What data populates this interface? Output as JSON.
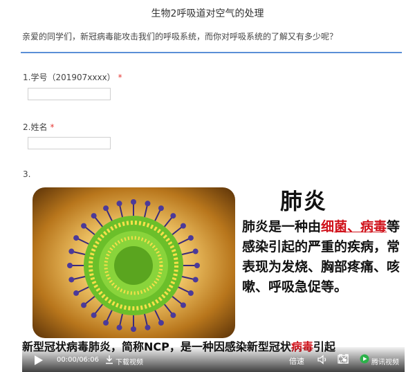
{
  "page": {
    "title": "生物2呼吸道对空气的处理",
    "intro": "亲爱的同学们，新冠病毒能攻击我们的呼吸系统，而你对呼吸系统的了解又有多少呢？"
  },
  "questions": [
    {
      "label": "1.学号（201907xxxx）",
      "required_mark": "*",
      "value": ""
    },
    {
      "label": "2.姓名",
      "required_mark": "*",
      "value": ""
    },
    {
      "label": "3."
    }
  ],
  "video": {
    "slide_title": "肺炎",
    "slide_text_1": "肺炎是一种由",
    "slide_text_red_1": "细",
    "slide_text_red_2": "菌、病毒",
    "slide_text_2": "等感染引起的严重的疾病，常表现为发烧、胸部疼痛、咳嗽、呼吸急促等。",
    "bottom_text_1": "新型冠状病毒肺炎，简称NCP，是一种因感染新型冠状",
    "bottom_text_red": "病毒",
    "bottom_text_2": "引起",
    "time": "00:00/06:06",
    "download_label": "下载视频",
    "speed_label": "倍速",
    "brand_label": "腾讯视频"
  }
}
